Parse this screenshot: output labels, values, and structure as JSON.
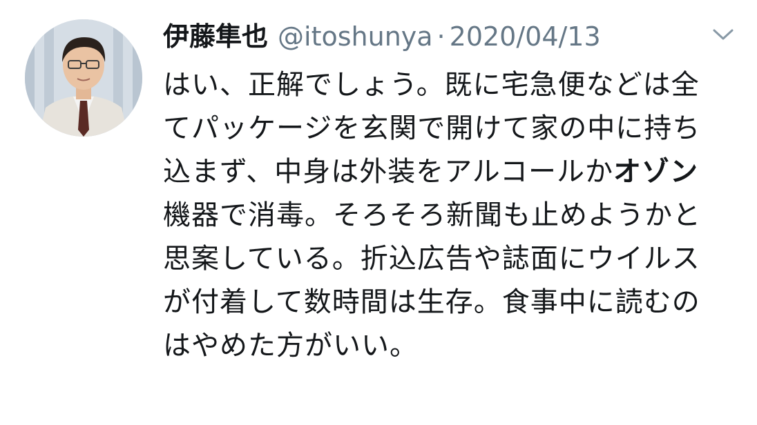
{
  "tweet": {
    "author": {
      "display_name": "伊藤隼也",
      "handle": "@itoshunya"
    },
    "separator": "·",
    "date": "2020/04/13",
    "text": {
      "part1": "はい、正解でしょう。既に宅急便などは全てパッケージを玄関で開けて家の中に持ち込まず、中身は外装をアルコールか",
      "emphasis": "オゾン",
      "part2": "機器で消毒。そろそろ新聞も止めようかと思案している。折込広告や誌面にウイルスが付着して数時間は生存。食事中に読むのはやめた方がいい。"
    },
    "menu_icon": "chevron-down-icon"
  },
  "colors": {
    "text_primary": "#14171a",
    "text_secondary": "#657786"
  }
}
